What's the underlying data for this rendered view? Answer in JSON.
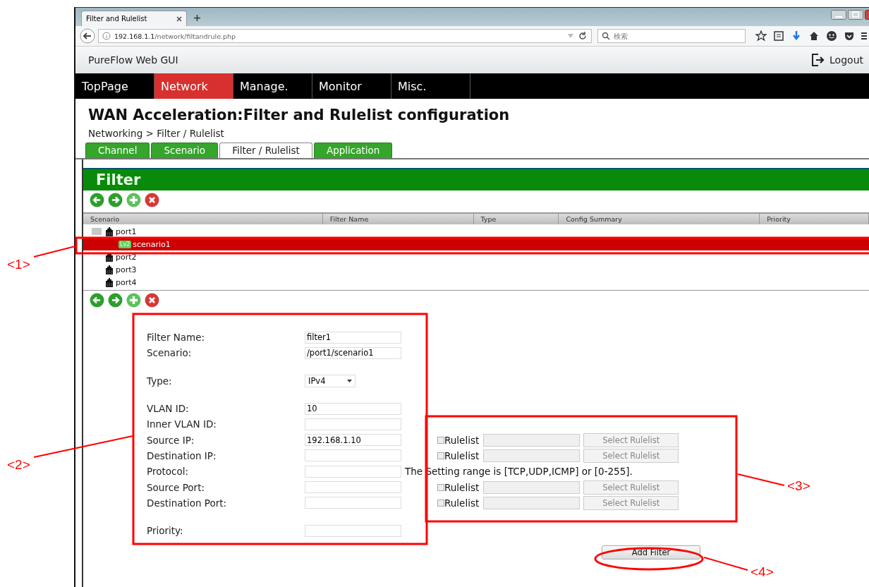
{
  "browser": {
    "tab_title": "Filter and Rulelist",
    "url_host": "192.168.1.1",
    "url_path": "/network/filtandrule.php",
    "search_placeholder": "検索"
  },
  "app": {
    "brand": "PureFlow Web GUI",
    "logout": "Logout"
  },
  "nav": [
    {
      "label": "TopPage",
      "selected": false
    },
    {
      "label": "Network",
      "selected": true
    },
    {
      "label": "Manage.",
      "selected": false
    },
    {
      "label": "Monitor",
      "selected": false
    },
    {
      "label": "Misc.",
      "selected": false
    }
  ],
  "page": {
    "title": "WAN Acceleration:Filter and Rulelist configuration",
    "breadcrumb": "Networking > Filter / Rulelist"
  },
  "subtabs": [
    {
      "label": "Channel",
      "selected": false
    },
    {
      "label": "Scenario",
      "selected": false
    },
    {
      "label": "Filter / Rulelist",
      "selected": true
    },
    {
      "label": "Application",
      "selected": false
    }
  ],
  "filter": {
    "heading": "Filter",
    "columns": [
      "Scenario",
      "Filter Name",
      "Type",
      "Config Summary",
      "Priority"
    ],
    "tree": [
      {
        "label": "port1",
        "expanded": true,
        "selected": false,
        "children": [
          {
            "label": "scenario1",
            "badge": "Lv2",
            "selected": true
          }
        ]
      },
      {
        "label": "port2",
        "selected": false
      },
      {
        "label": "port3",
        "selected": false
      },
      {
        "label": "port4",
        "selected": false
      }
    ]
  },
  "form": {
    "groups": [
      [
        {
          "label": "Filter Name:",
          "kind": "text",
          "value": "filter1"
        },
        {
          "label": "Scenario:",
          "kind": "text",
          "value": "/port1/scenario1"
        }
      ],
      [
        {
          "label": "Type:",
          "kind": "select",
          "value": "IPv4"
        }
      ],
      [
        {
          "label": "VLAN ID:",
          "kind": "text",
          "value": "10"
        },
        {
          "label": "Inner VLAN ID:",
          "kind": "text"
        },
        {
          "label": "Source IP:",
          "kind": "text",
          "value": "192.168.1.10",
          "rulelist": {
            "label": "Rulelist",
            "checked": false,
            "disabled": true,
            "button": "Select Rulelist"
          }
        },
        {
          "label": "Destination IP:",
          "kind": "text",
          "rulelist": {
            "label": "Rulelist",
            "checked": false,
            "disabled": true,
            "button": "Select Rulelist"
          }
        },
        {
          "label": "Protocol:",
          "kind": "text",
          "hint": "The Setting range is [TCP,UDP,ICMP] or [0-255]."
        },
        {
          "label": "Source Port:",
          "kind": "text",
          "rulelist": {
            "label": "Rulelist",
            "checked": false,
            "disabled": true,
            "button": "Select Rulelist"
          }
        },
        {
          "label": "Destination Port:",
          "kind": "text",
          "rulelist": {
            "label": "Rulelist",
            "checked": false,
            "disabled": true,
            "button": "Select Rulelist"
          }
        }
      ],
      [
        {
          "label": "Priority:",
          "kind": "text"
        }
      ]
    ],
    "submit": "Add Filter"
  },
  "annotations": [
    {
      "label": "<1>"
    },
    {
      "label": "<2>"
    },
    {
      "label": "<3>"
    },
    {
      "label": "<4>"
    }
  ]
}
